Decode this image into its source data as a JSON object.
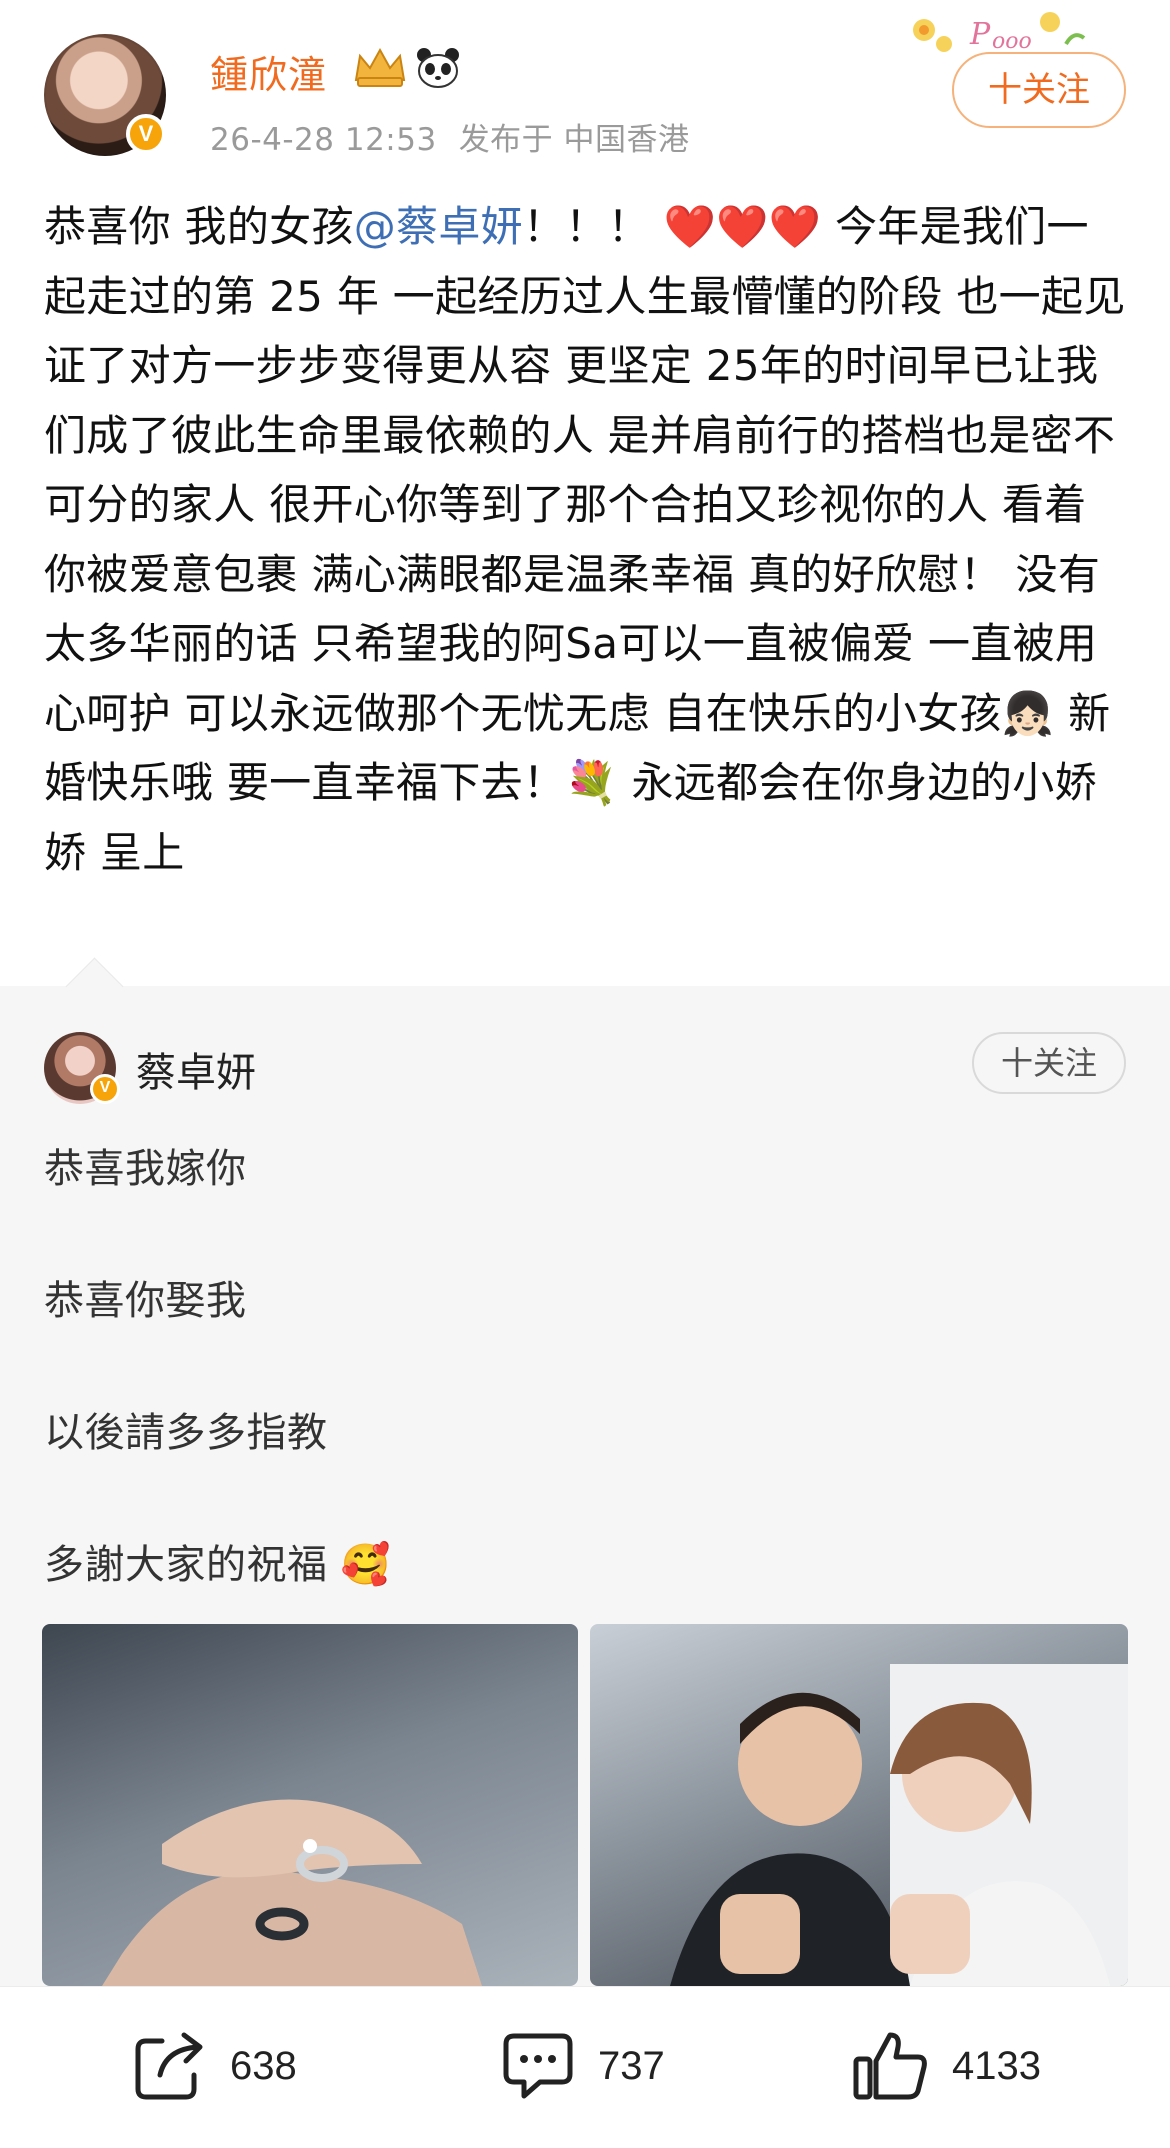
{
  "post": {
    "author": "鍾欣潼",
    "timestamp": "26-4-28 12:53",
    "location": "发布于 中国香港",
    "follow_label": "十关注",
    "text_before_mention": "恭喜你 我的女孩",
    "mention": "@蔡卓妍",
    "text_after_mention": "！！！ ❤️❤️❤️ 今年是我们一起走过的第 25 年 一起经历过人生最懵懂的阶段 也一起见证了对方一步步变得更从容 更坚定 25年的时间早已让我们成了彼此生命里最依赖的人 是并肩前行的搭档也是密不可分的家人 很开心你等到了那个合拍又珍视你的人 看着你被爱意包裹 满心满眼都是温柔幸福 真的好欣慰！ 没有太多华丽的话 只希望我的阿Sa可以一直被偏爱 一直被用心呵护 可以永远做那个无忧无虑 自在快乐的小女孩👧🏻 新婚快乐哦 要一直幸福下去！💐 永远都会在你身边的小娇娇 呈上",
    "badge_letter": "V"
  },
  "repost": {
    "author": "蔡卓妍",
    "follow_label": "十关注",
    "lines": [
      "恭喜我嫁你",
      "恭喜你娶我",
      "以後請多多指教",
      "多謝大家的祝福 🥰"
    ]
  },
  "actions": {
    "share_count": "638",
    "comment_count": "737",
    "like_count": "4133"
  },
  "icons": {
    "share": "share-icon",
    "comment": "comment-icon",
    "like": "thumbs-up-icon"
  },
  "colors": {
    "author": "#f06b1f",
    "mention": "#3e6fb5",
    "verify": "#f6a40a"
  }
}
